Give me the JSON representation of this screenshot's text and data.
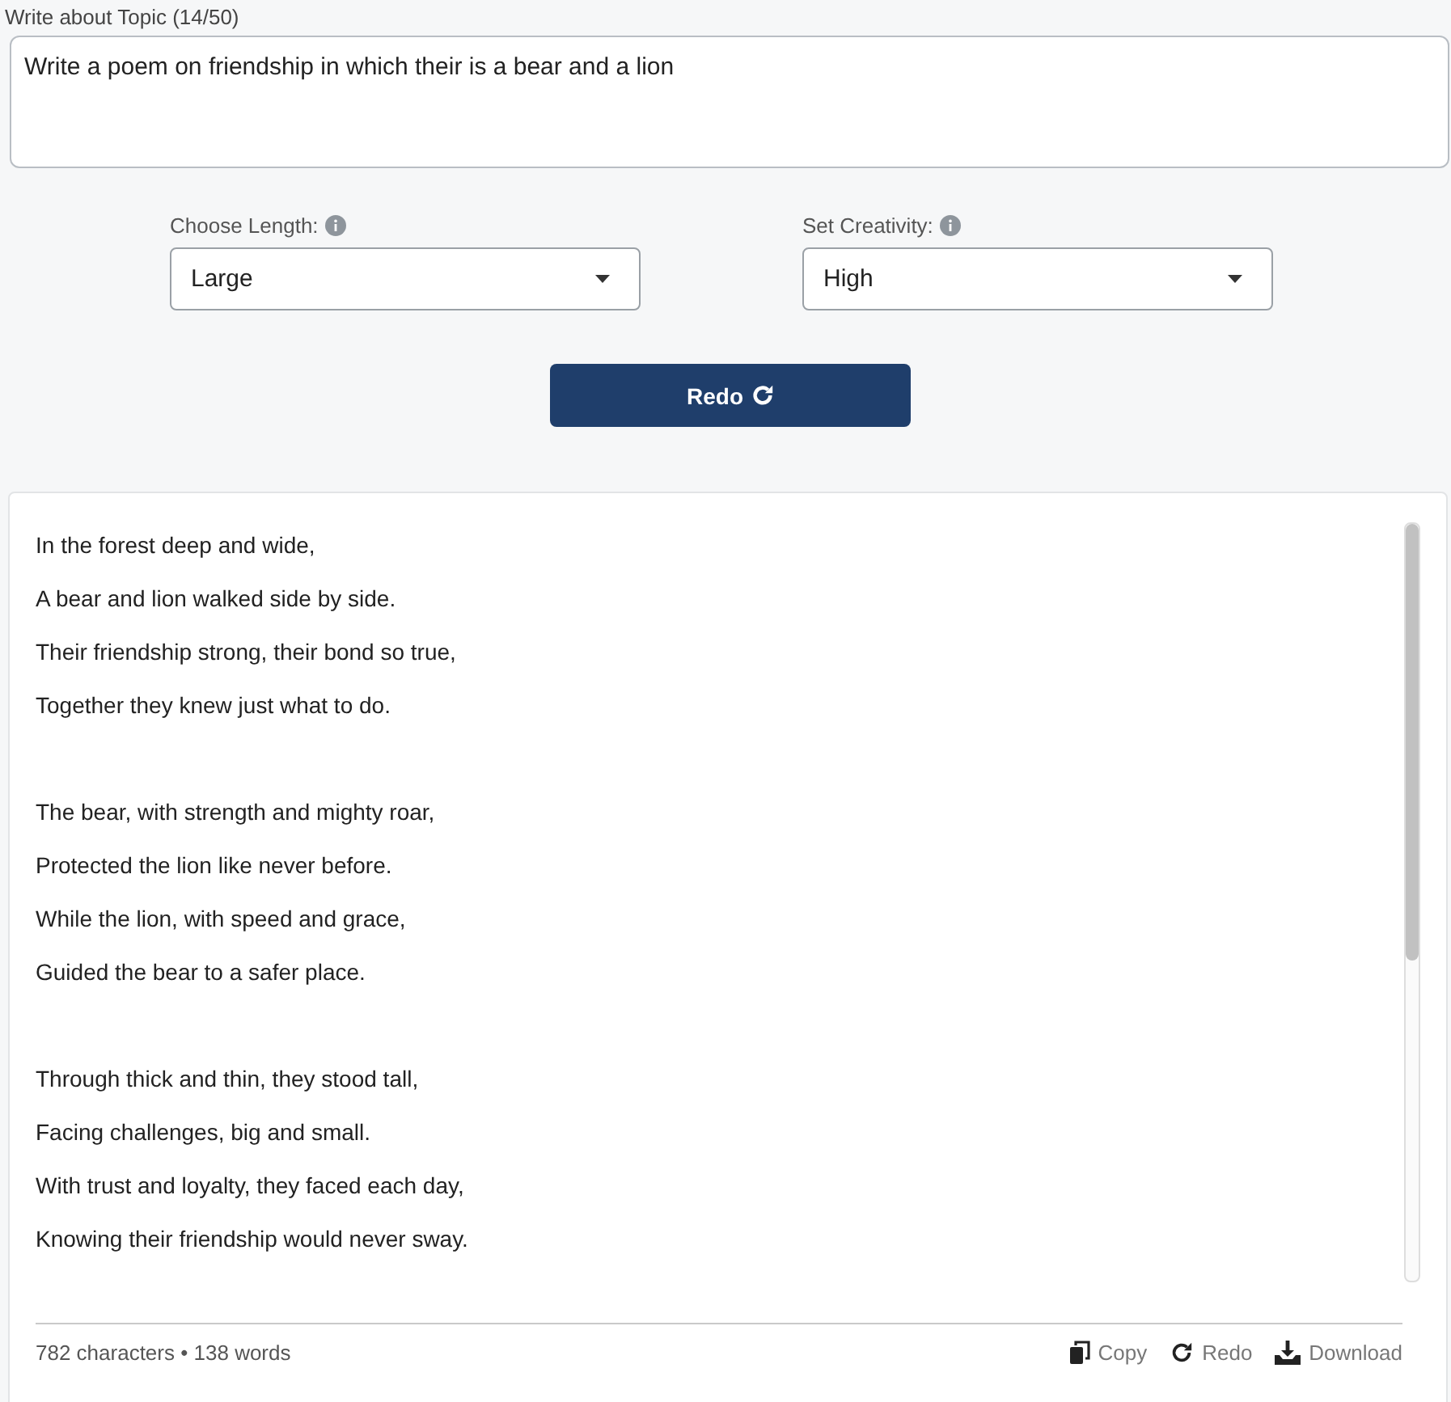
{
  "topic": {
    "label": "Write about Topic (14/50)",
    "value": "Write a poem on friendship in which their is a bear and a lion"
  },
  "selects": [
    {
      "label": "Choose Length:",
      "value": "Large"
    },
    {
      "label": "Set Creativity:",
      "value": "High"
    }
  ],
  "generate_button": "Redo",
  "poem": [
    [
      "In the forest deep and wide,",
      "A bear and lion walked side by side.",
      "Their friendship strong, their bond so true,",
      "Together they knew just what to do."
    ],
    [
      "The bear, with strength and mighty roar,",
      "Protected the lion like never before.",
      "While the lion, with speed and grace,",
      "Guided the bear to a safer place."
    ],
    [
      "Through thick and thin, they stood tall,",
      "Facing challenges, big and small.",
      "With trust and loyalty, they faced each day,",
      "Knowing their friendship would never sway."
    ]
  ],
  "stats": "782 characters • 138 words",
  "actions": [
    {
      "kind": "copy",
      "label": "Copy"
    },
    {
      "kind": "redo",
      "label": "Redo"
    },
    {
      "kind": "download",
      "label": "Download"
    }
  ]
}
